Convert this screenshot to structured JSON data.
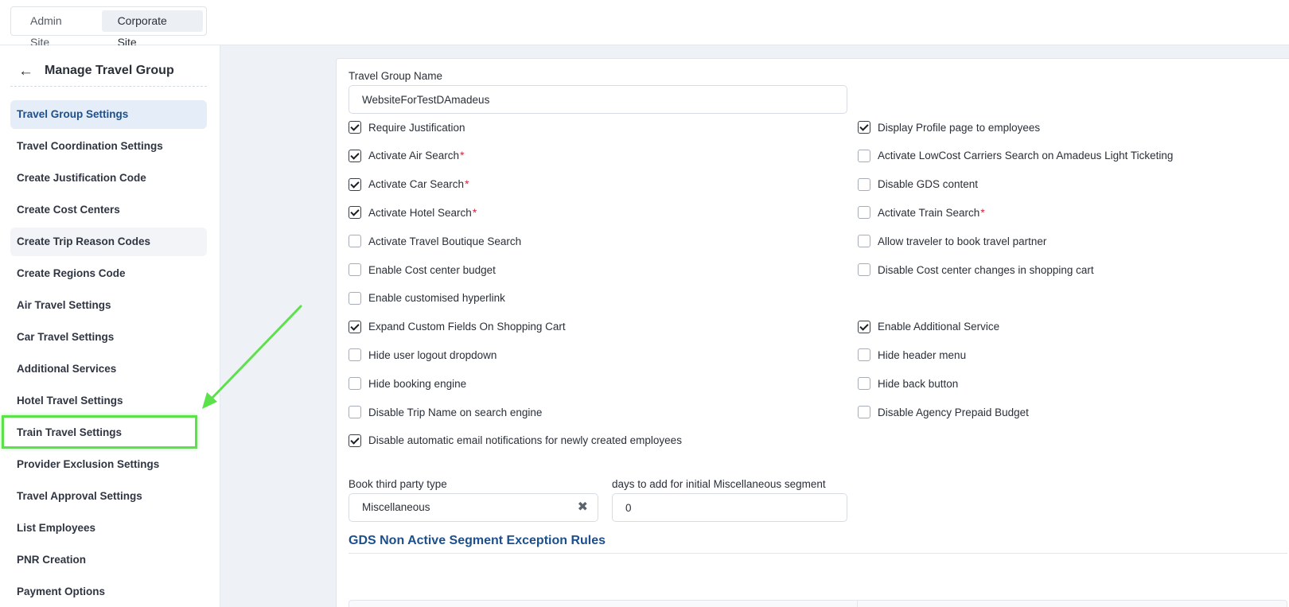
{
  "top": {
    "site_tabs": [
      {
        "label": "Admin Site",
        "active": false
      },
      {
        "label": "Corporate Site",
        "active": true
      }
    ]
  },
  "sidebar": {
    "title": "Manage Travel Group",
    "items": [
      {
        "label": "Travel Group Settings",
        "state": "active"
      },
      {
        "label": "Travel Coordination Settings",
        "state": ""
      },
      {
        "label": "Create Justification Code",
        "state": ""
      },
      {
        "label": "Create Cost Centers",
        "state": ""
      },
      {
        "label": "Create Trip Reason Codes",
        "state": "hover"
      },
      {
        "label": "Create Regions Code",
        "state": ""
      },
      {
        "label": "Air Travel Settings",
        "state": ""
      },
      {
        "label": "Car Travel Settings",
        "state": ""
      },
      {
        "label": "Additional Services",
        "state": ""
      },
      {
        "label": "Hotel Travel Settings",
        "state": ""
      },
      {
        "label": "Train Travel Settings",
        "state": "highlighted"
      },
      {
        "label": "Provider Exclusion Settings",
        "state": ""
      },
      {
        "label": "Travel Approval Settings",
        "state": ""
      },
      {
        "label": "List Employees",
        "state": ""
      },
      {
        "label": "PNR Creation",
        "state": ""
      },
      {
        "label": "Payment Options",
        "state": ""
      }
    ]
  },
  "form": {
    "group_name_label": "Travel Group Name",
    "group_name_value": "WebsiteForTestDAmadeus",
    "left_checks": [
      {
        "label": "Require Justification",
        "checked": true,
        "required": false
      },
      {
        "label": "Activate Air Search",
        "checked": true,
        "required": true
      },
      {
        "label": "Activate Car Search",
        "checked": true,
        "required": true
      },
      {
        "label": "Activate Hotel Search",
        "checked": true,
        "required": true
      },
      {
        "label": "Activate Travel Boutique Search",
        "checked": false,
        "required": false
      },
      {
        "label": "Enable Cost center budget",
        "checked": false,
        "required": false
      },
      {
        "label": "Enable customised hyperlink",
        "checked": false,
        "required": false
      },
      {
        "label": "Expand Custom Fields On Shopping Cart",
        "checked": true,
        "required": false
      },
      {
        "label": "Hide user logout dropdown",
        "checked": false,
        "required": false
      },
      {
        "label": "Hide booking engine",
        "checked": false,
        "required": false
      },
      {
        "label": "Disable Trip Name on search engine",
        "checked": false,
        "required": false
      },
      {
        "label": "Disable automatic email notifications for newly created employees",
        "checked": true,
        "required": false
      }
    ],
    "right_checks": [
      {
        "label": "Display Profile page to employees",
        "checked": true,
        "required": false
      },
      {
        "label": "Activate LowCost Carriers Search on Amadeus Light Ticketing",
        "checked": false,
        "required": false
      },
      {
        "label": "Disable GDS content",
        "checked": false,
        "required": false
      },
      {
        "label": "Activate Train Search",
        "checked": false,
        "required": true
      },
      {
        "label": "Allow traveler to book travel partner",
        "checked": false,
        "required": false
      },
      {
        "label": "Disable Cost center changes in shopping cart",
        "checked": false,
        "required": false
      },
      null,
      {
        "label": "Enable Additional Service",
        "checked": true,
        "required": false
      },
      {
        "label": "Hide header menu",
        "checked": false,
        "required": false
      },
      {
        "label": "Hide back button",
        "checked": false,
        "required": false
      },
      {
        "label": "Disable Agency Prepaid Budget",
        "checked": false,
        "required": false
      }
    ],
    "required_mark": "*",
    "third_party_label": "Book third party type",
    "third_party_value": "Miscellaneous",
    "days_label": "days to add for initial Miscellaneous segment",
    "days_value": "0",
    "section_title": "GDS Non Active Segment Exception Rules"
  },
  "colors": {
    "accent": "#1c4f8c",
    "highlight": "#5be24a",
    "required": "#d0243a"
  }
}
